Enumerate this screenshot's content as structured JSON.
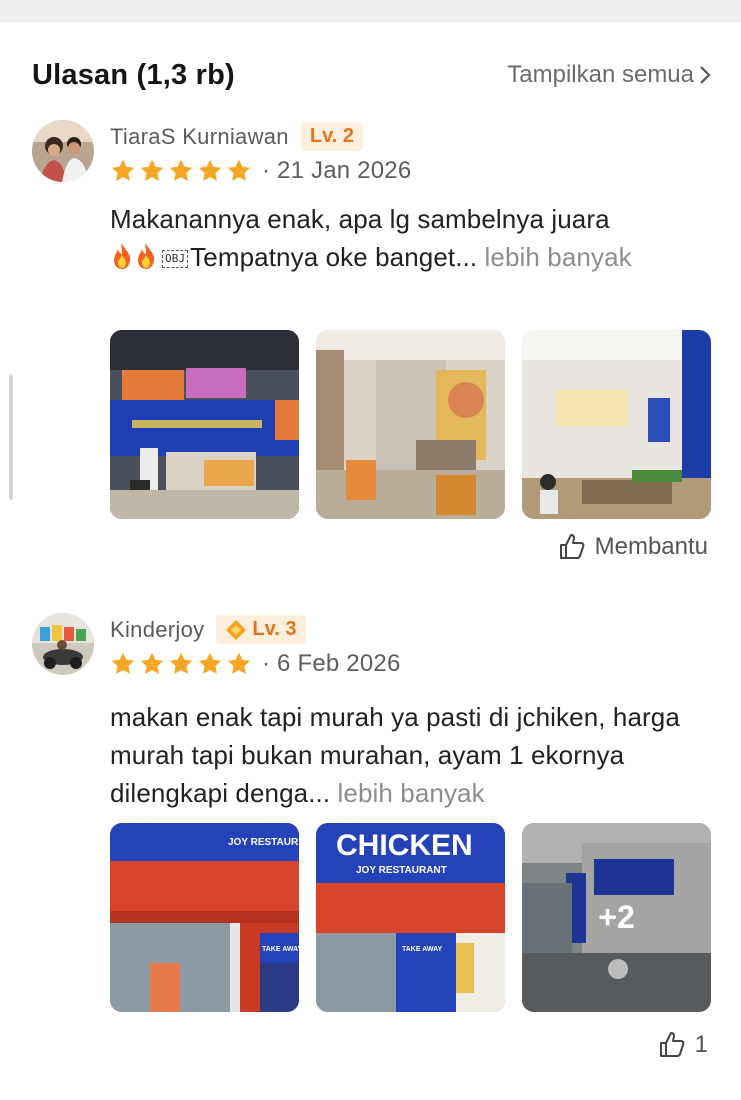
{
  "header": {
    "title": "Ulasan (1,3 rb)",
    "see_all_label": "Tampilkan semua"
  },
  "colors": {
    "star": "#f5a623",
    "level_text": "#e0761c",
    "level_bg": "#fdeede",
    "muted": "#8d8d8d"
  },
  "reviews": [
    {
      "user_name": "TiaraS Kurniawan",
      "level": "Lv. 2",
      "rating": 5,
      "date": "· 21 Jan 2026",
      "text_part1": "Makanannya enak, apa lg sambelnya juara ",
      "obj_marker": "OBJ",
      "text_part2": "Tempatnya oke banget...",
      "more_label": "lebih banyak",
      "photos": [
        "store-counter-photo",
        "dining-area-photo",
        "dining-wall-photo"
      ],
      "helpful_label": "Membantu"
    },
    {
      "user_name": "Kinderjoy",
      "level": "Lv. 3",
      "rating": 5,
      "date": "· 6 Feb 2026",
      "text_part1": "makan enak tapi murah ya pasti di jchiken, harga murah tapi bukan murahan, ayam 1 ekornya dilengkapi denga...",
      "more_label": "lebih banyak",
      "photos": [
        "storefront-photo",
        "storefront-sign-photo",
        "street-view-photo"
      ],
      "photo_sign_texts": {
        "joy_restaurant": "JOY RESTAURANT",
        "chicken": "CHICKEN",
        "take_away": "TAKE AWAY"
      },
      "more_photos_label": "+2",
      "helpful_count": "1"
    }
  ]
}
